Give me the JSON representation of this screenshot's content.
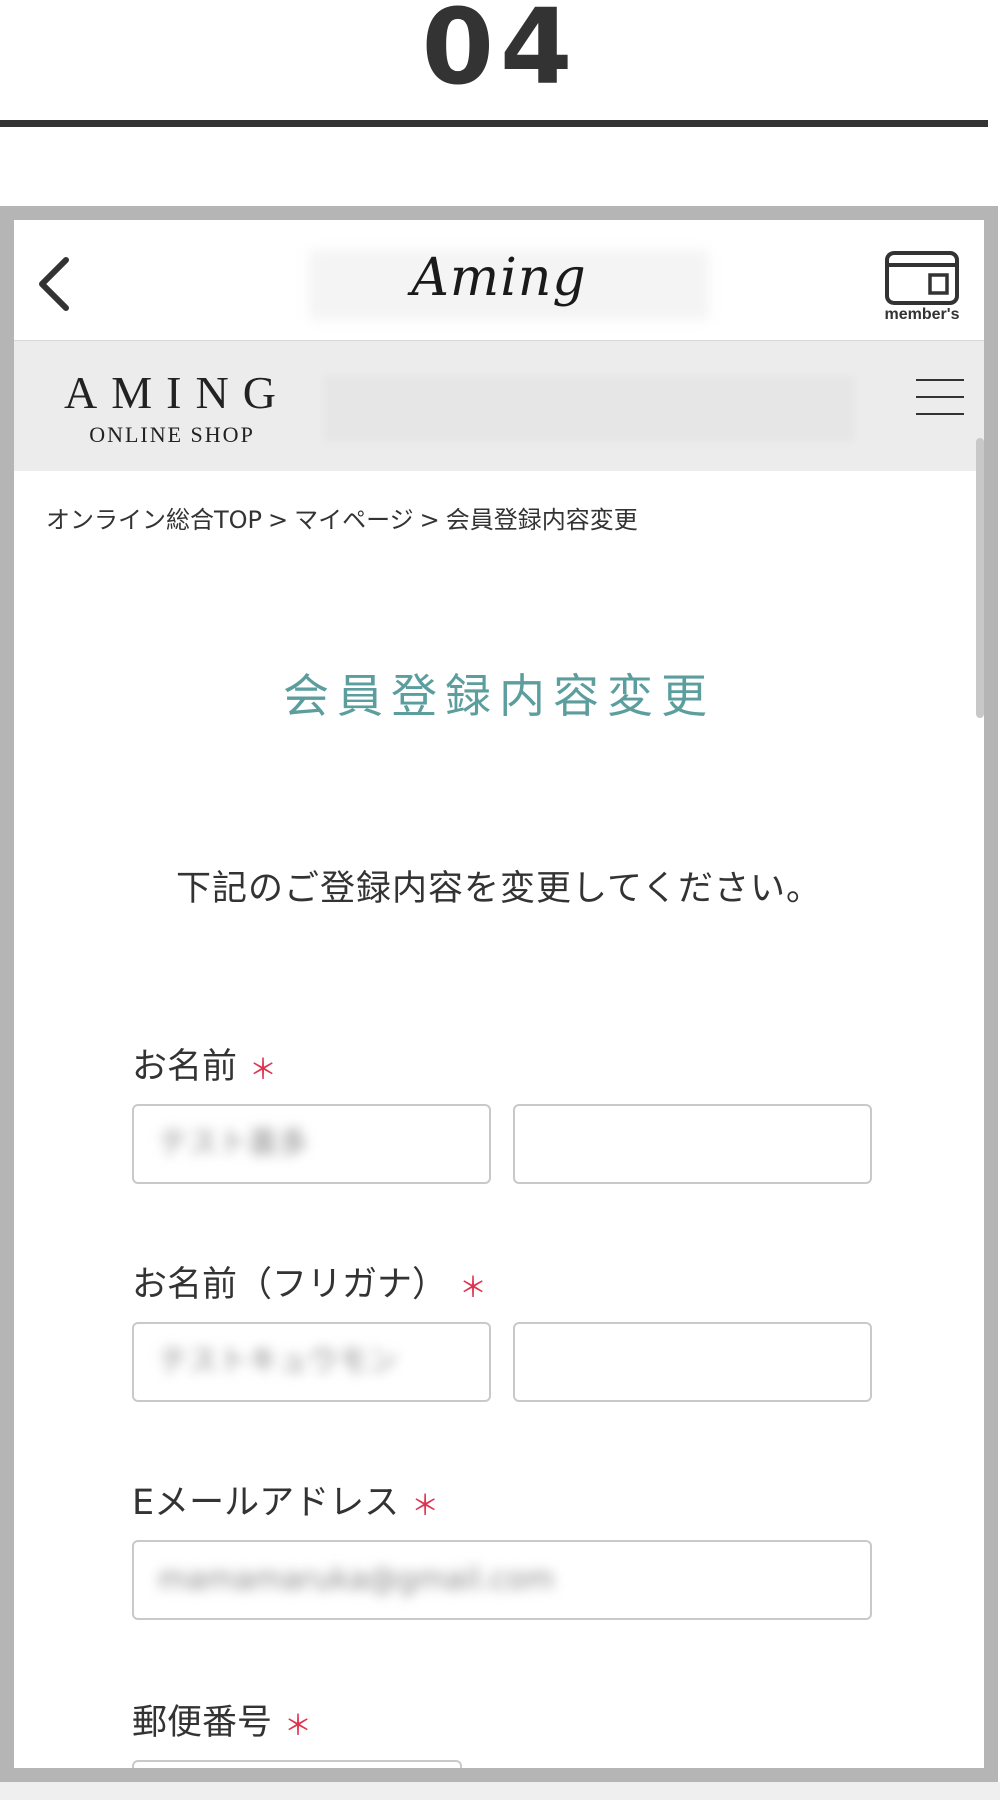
{
  "step_number": "04",
  "header": {
    "logo_text": "Aming",
    "member_label": "member's"
  },
  "shop": {
    "name": "AMING",
    "subtitle": "ONLINE SHOP"
  },
  "breadcrumb": {
    "items": [
      "オンライン総合TOP",
      "マイページ",
      "会員登録内容変更"
    ],
    "separator": ">"
  },
  "page_title": "会員登録内容変更",
  "instruction": "下記のご登録内容を変更してください。",
  "required_mark": "＊",
  "form": {
    "name_label": "お名前",
    "name_last_value": "テスト喜多",
    "name_first_value": "",
    "kana_label": "お名前（フリガナ）",
    "kana_last_value": "テストキュウモン",
    "kana_first_value": "",
    "email_label": "Eメールアドレス",
    "email_value": "mamamaruka@gmail.com",
    "zip_label": "郵便番号"
  },
  "colors": {
    "accent_title": "#5c9e9e",
    "required": "#e0334f",
    "frame": "#b5b5b5",
    "shop_bar": "#ececec"
  }
}
